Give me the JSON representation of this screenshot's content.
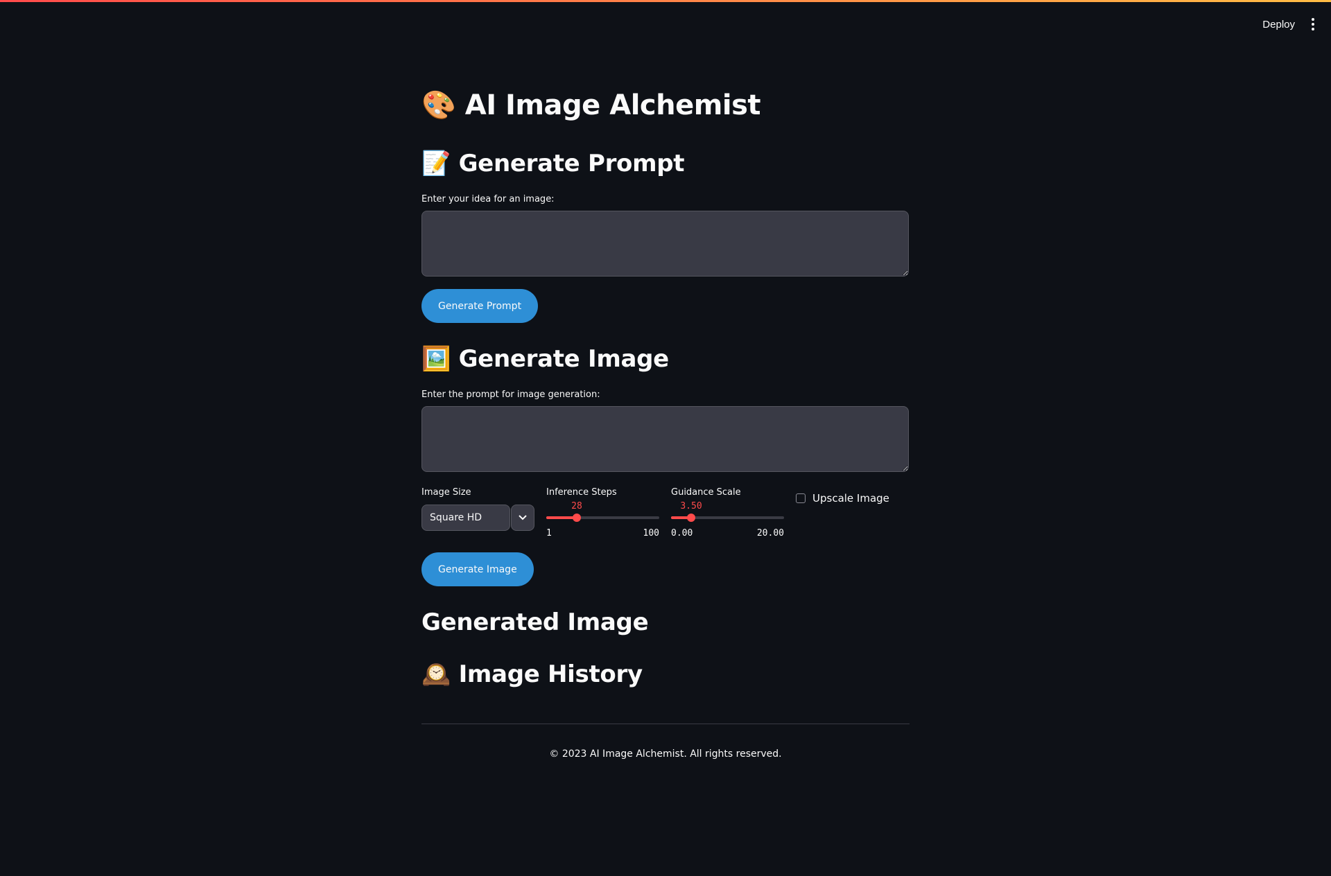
{
  "header": {
    "deploy_label": "Deploy",
    "menu_icon": "kebab-menu-icon"
  },
  "page": {
    "title": "🎨 AI Image Alchemist"
  },
  "generate_prompt": {
    "heading": "📝 Generate Prompt",
    "idea_label": "Enter your idea for an image:",
    "idea_value": "",
    "button_label": "Generate Prompt"
  },
  "generate_image": {
    "heading": "🖼️ Generate Image",
    "prompt_label": "Enter the prompt for image generation:",
    "prompt_value": "",
    "image_size": {
      "label": "Image Size",
      "selected": "Square HD"
    },
    "inference_steps": {
      "label": "Inference Steps",
      "value": "28",
      "min": "1",
      "max": "100",
      "numeric": 28,
      "range": [
        1,
        100
      ]
    },
    "guidance_scale": {
      "label": "Guidance Scale",
      "value": "3.50",
      "min": "0.00",
      "max": "20.00",
      "numeric": 3.5,
      "range": [
        0,
        20
      ]
    },
    "upscale": {
      "label": "Upscale Image",
      "checked": false
    },
    "button_label": "Generate Image"
  },
  "generated_image": {
    "heading": "Generated Image"
  },
  "image_history": {
    "heading": "🕰️ Image History"
  },
  "footer": {
    "text": "© 2023 AI Image Alchemist. All rights reserved."
  },
  "colors": {
    "background": "#0e1117",
    "accent": "#ff4b4b",
    "button": "#2e8fd6",
    "input_bg": "#393a45"
  }
}
